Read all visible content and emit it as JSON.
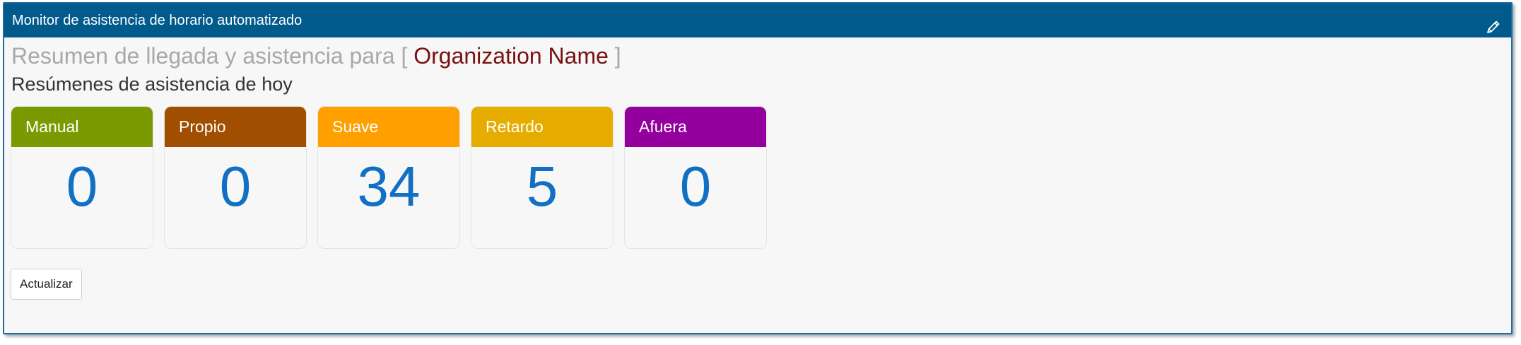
{
  "widget": {
    "title": "Monitor de asistencia de horario automatizado",
    "edit_icon": "pencil-icon"
  },
  "summary": {
    "heading_prefix": "Resumen de llegada y asistencia para",
    "bracket_open": "[",
    "organization_name": "Organization Name",
    "bracket_close": "]",
    "subheading": "Resúmenes de asistencia de hoy"
  },
  "cards": [
    {
      "label": "Manual",
      "value": "0",
      "color": "#7a9a01"
    },
    {
      "label": "Propio",
      "value": "0",
      "color": "#a04f00"
    },
    {
      "label": "Suave",
      "value": "34",
      "color": "#ffa000"
    },
    {
      "label": "Retardo",
      "value": "5",
      "color": "#e6ac00"
    },
    {
      "label": "Afuera",
      "value": "0",
      "color": "#94009e"
    }
  ],
  "actions": {
    "refresh_label": "Actualizar"
  },
  "colors": {
    "titlebar": "#005a8c",
    "value_text": "#1170c4",
    "organization_name": "#7a1010"
  }
}
